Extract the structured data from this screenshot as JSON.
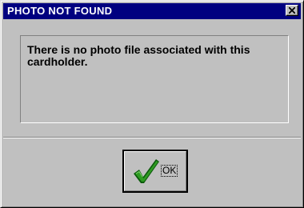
{
  "dialog": {
    "title": "PHOTO NOT FOUND",
    "message": "There is no photo file associated with this cardholder.",
    "close_icon": "close-x",
    "ok_label": "OK",
    "ok_icon": "green-checkmark",
    "colors": {
      "titlebar": "#000080",
      "face": "#c0c0c0",
      "check_green": "#2e9b22",
      "check_dark": "#0b5a0b"
    }
  }
}
